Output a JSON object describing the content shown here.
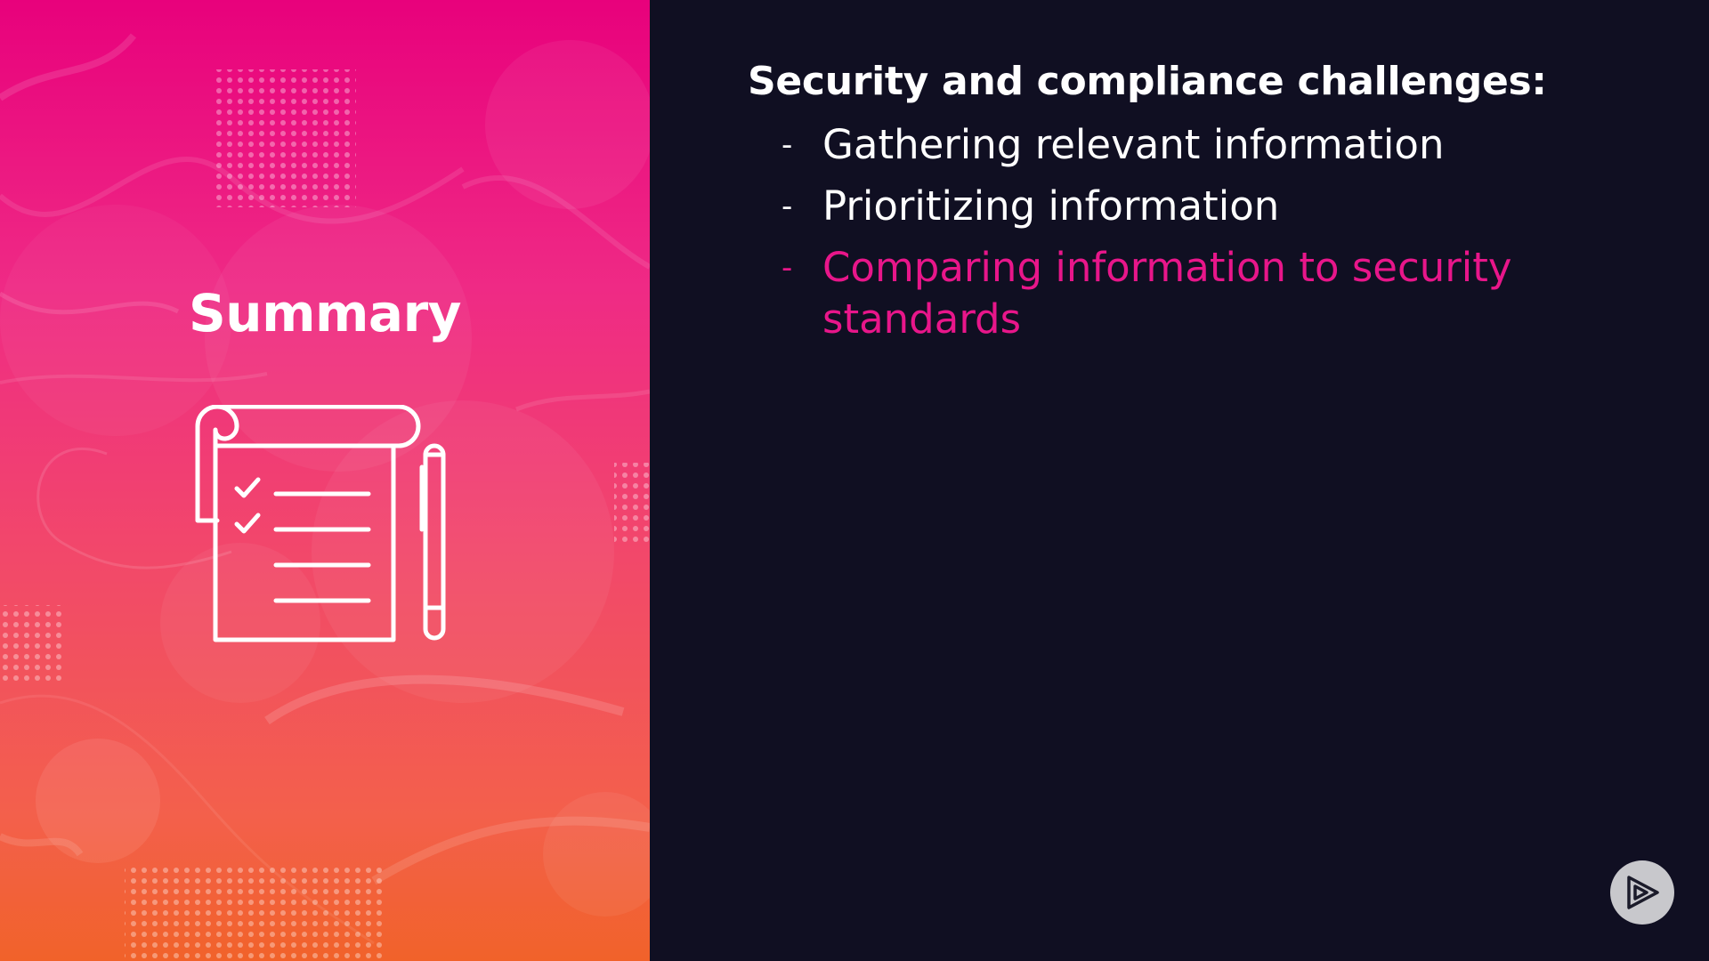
{
  "summary": {
    "title": "Summary",
    "icon": "notepad-checklist-pen-icon"
  },
  "content": {
    "heading": "Security and compliance challenges:",
    "bullets": [
      {
        "marker": "-",
        "text": "Gathering relevant information",
        "highlighted": false
      },
      {
        "marker": "-",
        "text": "Prioritizing information",
        "highlighted": false
      },
      {
        "marker": "-",
        "text": "Comparing information to security standards",
        "highlighted": true
      }
    ]
  },
  "colors": {
    "background": "#100f22",
    "accent": "#e8168a",
    "gradient_top": "#e8017c",
    "gradient_bottom": "#f1622a",
    "text": "#ffffff"
  },
  "logo": {
    "icon": "pluralsight-play-logo-icon"
  }
}
